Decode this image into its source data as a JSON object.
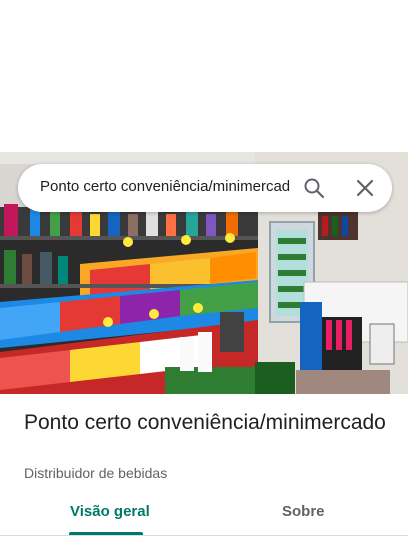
{
  "search": {
    "query": "Ponto certo conveniência/minimercado",
    "search_icon": "search-icon",
    "close_icon": "close-icon"
  },
  "photo": {
    "description_icon": "store-photo"
  },
  "place": {
    "name": "Ponto certo conveniência/minimercado",
    "category": "Distribuidor de bebidas"
  },
  "tabs": [
    {
      "label": "Visão geral",
      "active": true
    },
    {
      "label": "Sobre",
      "active": false
    }
  ],
  "colors": {
    "accent": "#00796b",
    "text_primary": "#202124",
    "text_secondary": "#5f6368"
  }
}
